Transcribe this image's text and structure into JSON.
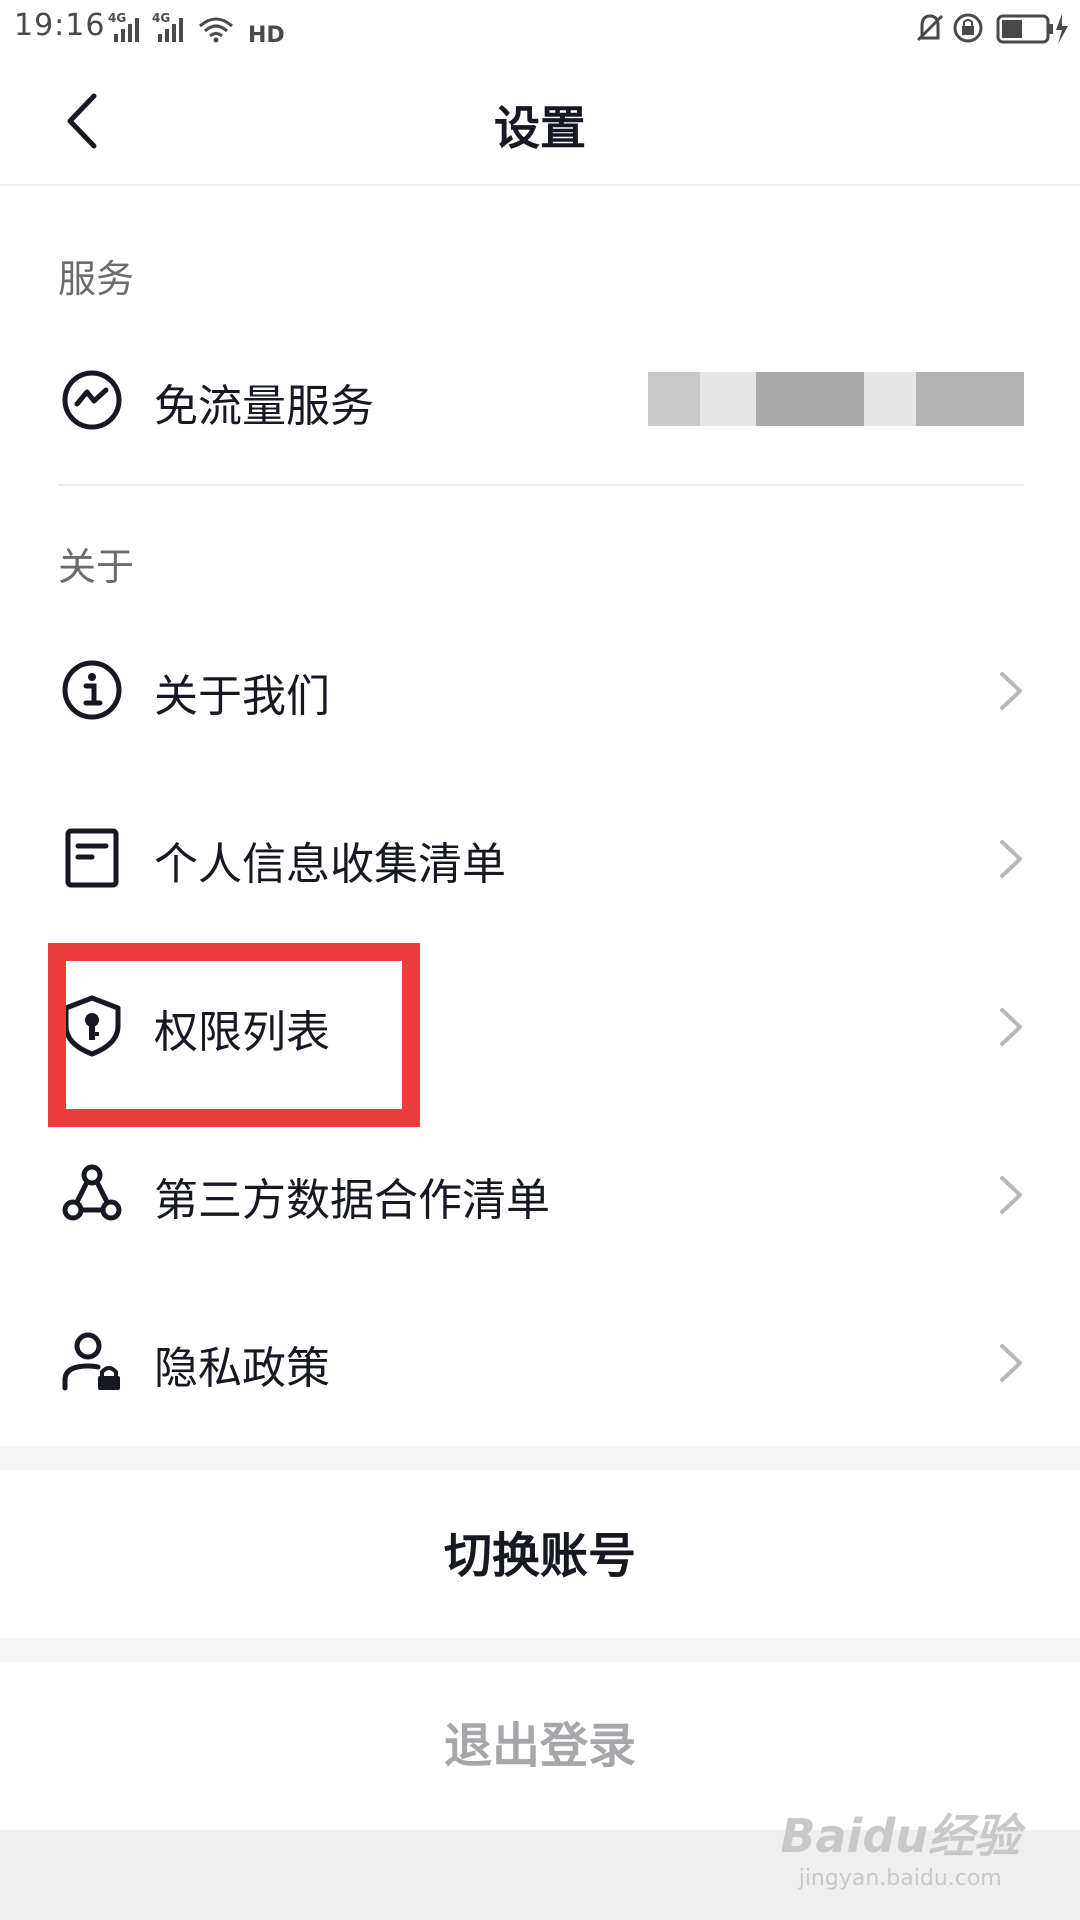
{
  "status_bar": {
    "time": "19:16",
    "network_1": "4G",
    "network_2": "4G",
    "hd_label": "HD"
  },
  "nav": {
    "title": "设置",
    "back_icon": "chevron-left-icon"
  },
  "sections": {
    "service_header": "服务",
    "about_header": "关于"
  },
  "service_items": [
    {
      "label": "免流量服务",
      "icon": "data-free-icon"
    }
  ],
  "about_items": [
    {
      "label": "关于我们",
      "icon": "info-icon"
    },
    {
      "label": "个人信息收集清单",
      "icon": "document-icon"
    },
    {
      "label": "权限列表",
      "icon": "shield-key-icon"
    },
    {
      "label": "第三方数据合作清单",
      "icon": "network-icon"
    },
    {
      "label": "隐私政策",
      "icon": "user-lock-icon"
    }
  ],
  "actions": {
    "switch_account": "切换账号",
    "logout": "退出登录"
  },
  "watermark": {
    "logo": "Baidu经验",
    "url": "jingyan.baidu.com"
  },
  "colors": {
    "highlight": "#ee3b3b",
    "text_primary": "#161823",
    "text_secondary": "#6b6b70",
    "text_disabled": "#a7a7ab",
    "chevron": "#b8b8bc"
  }
}
